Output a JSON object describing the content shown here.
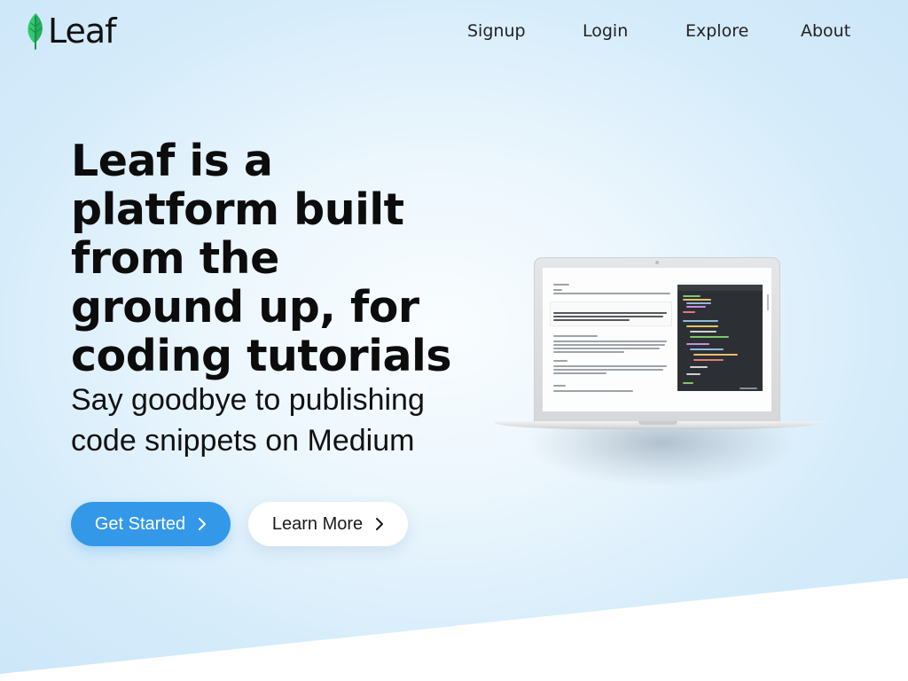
{
  "brand": {
    "name": "Leaf",
    "logo_icon": "leaf-icon",
    "accent_color": "#3498e8",
    "leaf_color": "#2ecc71"
  },
  "nav": {
    "items": [
      {
        "label": "Signup"
      },
      {
        "label": "Login"
      },
      {
        "label": "Explore"
      },
      {
        "label": "About"
      }
    ]
  },
  "hero": {
    "headline": "Leaf is a platform built from the ground up, for coding tutorials",
    "subheadline": "Say goodbye to publishing code snippets on Medium",
    "primary_button": {
      "label": "Get Started",
      "icon": "chevron-right-icon"
    },
    "secondary_button": {
      "label": "Learn More",
      "icon": "chevron-right-icon"
    }
  },
  "illustration": {
    "name": "laptop-mockup"
  }
}
